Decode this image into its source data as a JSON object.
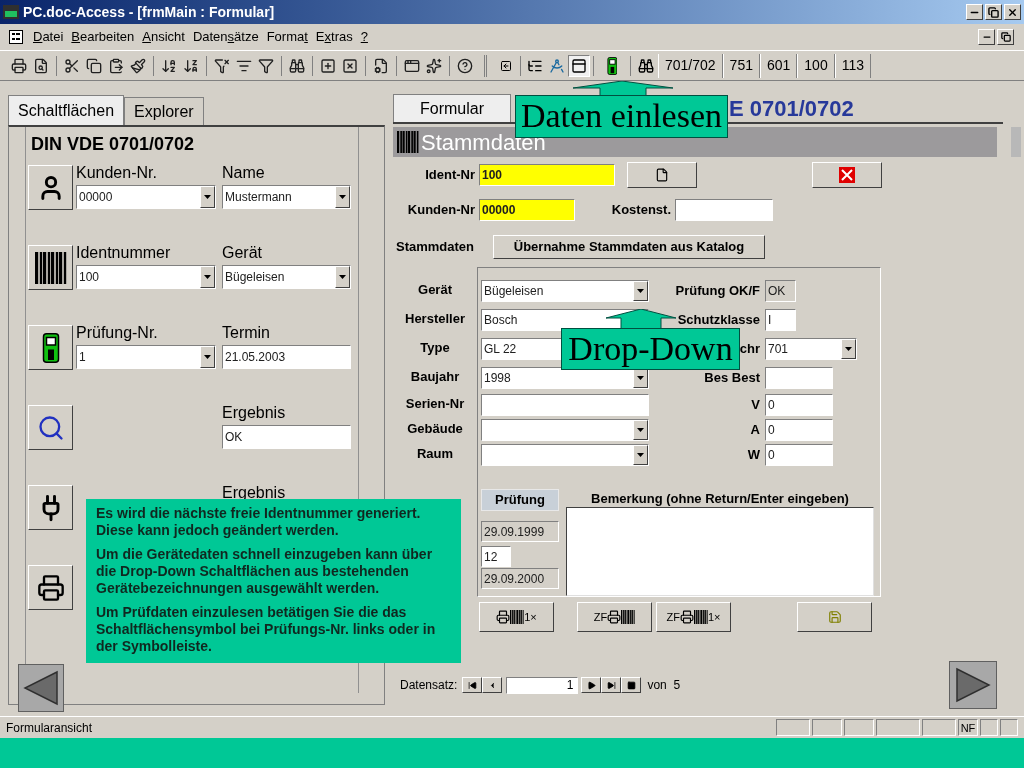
{
  "window": {
    "title": "PC.doc-Access - [frmMain : Formular]"
  },
  "menu": [
    {
      "key": "D",
      "post": "atei"
    },
    {
      "key": "B",
      "post": "earbeiten"
    },
    {
      "key": "A",
      "post": "nsicht"
    },
    {
      "pre": "Daten",
      "key": "s",
      "post": "ätze"
    },
    {
      "pre": "Forma",
      "key": "t"
    },
    {
      "pre": "E",
      "key": "x",
      "post": "tras"
    },
    {
      "key": "?"
    }
  ],
  "toolbar_text_buttons": [
    "701/702",
    "751",
    "601",
    "100",
    "113"
  ],
  "left_panel": {
    "tabs": [
      {
        "label": "Schaltflächen",
        "selected": true
      },
      {
        "label": "Explorer",
        "selected": false
      }
    ],
    "title": "DIN VDE 0701/0702",
    "rows": [
      {
        "first": {
          "label": "Kunden-Nr.",
          "value": "00000",
          "kind": "combo"
        },
        "second": {
          "label": "Name",
          "value": "Mustermann",
          "kind": "combo"
        }
      },
      {
        "first": {
          "label": "Identnummer",
          "value": "100",
          "kind": "combo"
        },
        "second": {
          "label": "Gerät",
          "value": "Bügeleisen",
          "kind": "combo"
        }
      },
      {
        "first": {
          "label": "Prüfung-Nr.",
          "value": "1",
          "kind": "combo"
        },
        "second": {
          "label": "Termin",
          "value": "21.05.2003",
          "kind": "text"
        }
      },
      {
        "second": {
          "label": "Ergebnis",
          "value": "OK",
          "kind": "text"
        }
      },
      {
        "second": {
          "label": "Ergebnis",
          "kind": "hidden"
        }
      },
      {}
    ]
  },
  "form": {
    "tab": {
      "label": "Formular",
      "selected": true
    },
    "heading": "E 0701/0702",
    "section": "Stammdaten",
    "ident": {
      "label": "Ident-Nr",
      "value": "100",
      "required": true
    },
    "customer": {
      "label": "Kunden-Nr",
      "value": "00000",
      "required": true
    },
    "cost_center": {
      "label": "Kostenst.",
      "required": false
    },
    "catalog": {
      "label": "Stammdaten",
      "button": "Übernahme Stammdaten aus Katalog"
    },
    "left_fields": [
      {
        "label": "Gerät",
        "value": "Bügeleisen",
        "kind": "combo"
      },
      {
        "label": "Hersteller",
        "value": "Bosch",
        "kind": "text"
      },
      {
        "label": "Type",
        "value": "GL 22",
        "kind": "text"
      },
      {
        "label": "Baujahr",
        "value": "1998",
        "kind": "combo"
      },
      {
        "label": "Serien-Nr",
        "kind": "text"
      },
      {
        "label": "Gebäude",
        "kind": "combo"
      },
      {
        "label": "Raum",
        "kind": "combo"
      }
    ],
    "right_fields": [
      {
        "label": "Prüfung OK/F",
        "value": "OK",
        "kind": "readonly"
      },
      {
        "label": "Schutzklasse",
        "value": "I",
        "kind": "short"
      },
      {
        "label": "chr",
        "value": "701",
        "kind": "combo"
      },
      {
        "label": "Bes Best",
        "kind": "text"
      },
      {
        "label": "V",
        "value": "0",
        "kind": "text"
      },
      {
        "label": "A",
        "value": "0",
        "kind": "text"
      },
      {
        "label": "W",
        "value": "0",
        "kind": "text"
      }
    ],
    "inspection": {
      "header": "Prüfung",
      "last_date": "29.09.1999",
      "interval": "12",
      "next_date": "29.09.2000"
    },
    "remark": {
      "label": "Bemerkung (ohne Return/Enter eingeben)"
    },
    "print_buttons": [
      {
        "suffix": "1×"
      },
      {
        "prefix": "ZF"
      },
      {
        "prefix": "ZF",
        "suffix": "1×"
      }
    ],
    "navigation": {
      "label": "Datensatz:",
      "record": "1",
      "of": "von",
      "total": "5"
    }
  },
  "status_bar": {
    "text": "Formularansicht",
    "indicators": [
      {
        "label": "NF"
      }
    ]
  },
  "callouts": [
    "Daten einlesen",
    "Drop-Down"
  ],
  "help_box": [
    "Es wird die nächste freie Identnummer generiert. Diese kann jedoch geändert werden.",
    "Um die Gerätedaten schnell einzugeben kann über die Drop-Down Schaltflächen aus bestehenden Gerätebezeichnungen ausgewählt werden.",
    "Um Prüfdaten einzulesen betätigen Sie die das Schaltflächensymbol bei Prüfungs-Nr. links oder in der Symbolleiste."
  ]
}
